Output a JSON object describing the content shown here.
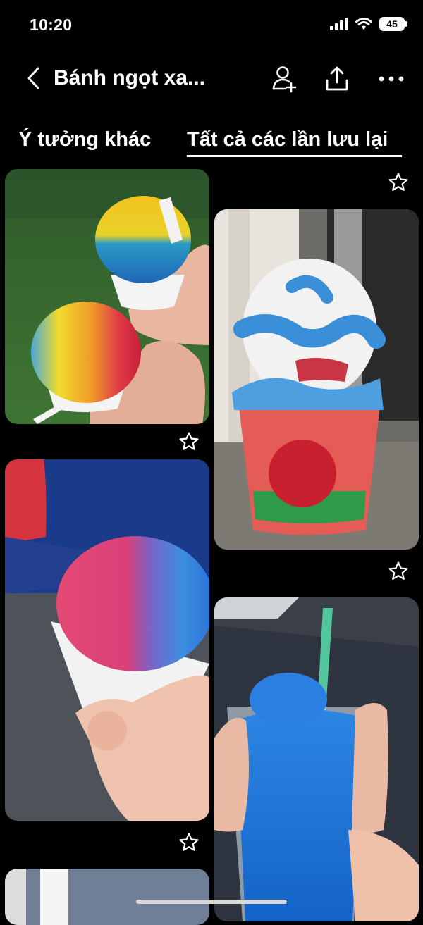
{
  "status_bar": {
    "time": "10:20",
    "battery": "45",
    "icons": [
      "signal-icon",
      "wifi-icon",
      "battery-icon"
    ]
  },
  "header": {
    "title": "Bánh ngọt xa...",
    "actions": [
      "back-icon",
      "add-collaborator-icon",
      "share-icon",
      "more-icon"
    ]
  },
  "tabs": [
    {
      "label": "Ý tưởng khác",
      "selected": false
    },
    {
      "label": "Tất cả các lần lưu lại",
      "selected": true
    }
  ],
  "pins": {
    "left": [
      {
        "name": "rainbow-shave-ice-pin",
        "favorite_icon": "star-icon"
      },
      {
        "name": "blue-red-shave-ice-pin",
        "favorite_icon": "star-icon"
      },
      {
        "name": "partial-pin"
      }
    ],
    "right": [
      {
        "name": "rosati-ice-cup-pin",
        "favorite_icon": "star-icon"
      },
      {
        "name": "blue-slushie-pin"
      }
    ],
    "top_right_favorite_icon": "star-icon"
  },
  "colors": {
    "background": "#000000",
    "text": "#ffffff"
  }
}
